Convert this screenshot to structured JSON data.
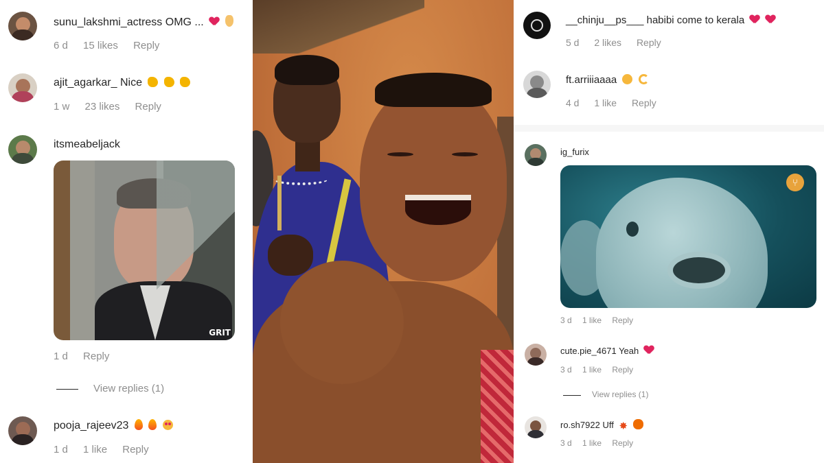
{
  "left_comments": [
    {
      "username": "sunu_lakshmi_actress",
      "text": "OMG ...",
      "meta": {
        "age": "6 d",
        "likes": "15 likes",
        "reply": "Reply"
      }
    },
    {
      "username": "ajit_agarkar_",
      "text": "Nice",
      "meta": {
        "age": "1 w",
        "likes": "23 likes",
        "reply": "Reply"
      }
    },
    {
      "username": "itsmeabeljack",
      "text": "",
      "gif_watermark": "GRIT",
      "meta": {
        "age": "1 d",
        "reply": "Reply"
      },
      "view_replies": "View replies (1)"
    },
    {
      "username": "pooja_rajeev23",
      "text": "",
      "meta": {
        "age": "1 d",
        "likes": "1 like",
        "reply": "Reply"
      }
    }
  ],
  "right_comments": [
    {
      "username": "__chinju__ps___",
      "text": "habibi come to kerala",
      "meta": {
        "age": "5 d",
        "likes": "2 likes",
        "reply": "Reply"
      }
    },
    {
      "username": "ft.arriiiaaaa",
      "text": "",
      "meta": {
        "age": "4 d",
        "likes": "1 like",
        "reply": "Reply"
      }
    },
    {
      "username": "ig_furix",
      "text": "",
      "meta": {
        "age": "3 d",
        "likes": "1 like",
        "reply": "Reply"
      }
    },
    {
      "username": "cute.pie_4671",
      "text": "Yeah",
      "meta": {
        "age": "3 d",
        "likes": "1 like",
        "reply": "Reply"
      },
      "view_replies": "View replies (1)"
    },
    {
      "username": "ro.sh7922",
      "text": "Uff",
      "meta": {
        "age": "3 d",
        "likes": "1 like",
        "reply": "Reply"
      }
    }
  ],
  "colors": {
    "heart": "#e0245e",
    "meta_text": "#8e8e8e",
    "text": "#262626"
  },
  "icons": [
    "heart-icon",
    "ok-hand-icon",
    "clapping-hands-icon",
    "fire-icon",
    "heart-eyes-icon",
    "grinning-icon",
    "dizzy-icon",
    "anger-icon",
    "devil-icon",
    "gif-badge-icon"
  ]
}
